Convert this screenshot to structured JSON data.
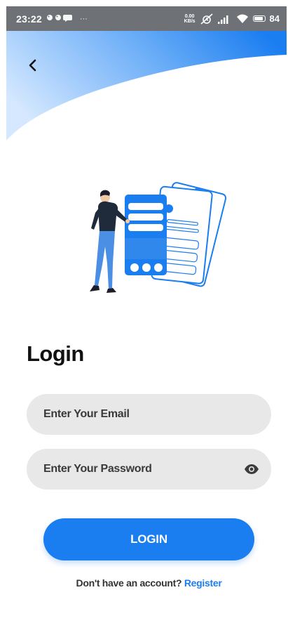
{
  "status_bar": {
    "time": "23:22",
    "notification_glyphs": "Ὦ0",
    "more": "···",
    "net_speed_value": "0.00",
    "net_speed_unit": "KB/s",
    "battery_level": "84"
  },
  "header": {
    "back_icon": "chevron-left-icon",
    "gradient": [
      "#cfe4ff",
      "#1a7df0"
    ]
  },
  "login": {
    "title": "Login",
    "email_placeholder": "Enter Your Email",
    "password_placeholder": "Enter Your Password",
    "password_toggle_icon": "eye-icon",
    "login_button": "LOGIN",
    "no_account_text": "Don't have an account?",
    "register_link": "Register"
  },
  "colors": {
    "accent": "#1a7df0",
    "field_bg": "#e8e8e8",
    "title": "#111111",
    "status_bar": "#6e7276"
  }
}
